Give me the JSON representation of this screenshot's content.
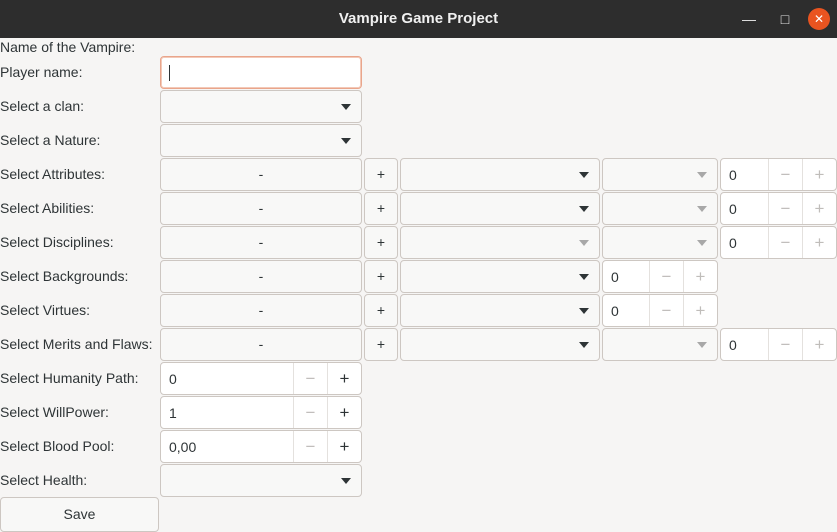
{
  "window": {
    "title": "Vampire Game Project",
    "minimize": "—",
    "maximize": "□",
    "close": "✕"
  },
  "form": {
    "name_label": "Name of the Vampire:",
    "player_label": "Player name:",
    "player_value": "",
    "clan_label": "Select a clan:",
    "nature_label": "Select a Nature:",
    "attributes_label": "Select Attributes:",
    "abilities_label": "Select Abilities:",
    "disciplines_label": "Select Disciplines:",
    "backgrounds_label": "Select Backgrounds:",
    "virtues_label": "Select Virtues:",
    "merits_label": "Select Merits and Flaws:",
    "humanity_label": "Select Humanity Path:",
    "willpower_label": "Select WillPower:",
    "bloodpool_label": "Select Blood Pool:",
    "health_label": "Select Health:",
    "minus_label": "-",
    "plus_label": "+",
    "spin_minus": "−",
    "spin_plus": "+",
    "attributes_value": "0",
    "abilities_value": "0",
    "disciplines_value": "0",
    "backgrounds_value": "0",
    "virtues_value": "0",
    "merits_value": "0",
    "humanity_value": "0",
    "willpower_value": "1",
    "bloodpool_value": "0,00",
    "save_label": "Save"
  },
  "colors": {
    "titlebar": "#2d2d2d",
    "close_button": "#e95420",
    "background": "#f6f5f4",
    "focus_border": "#e9a58b"
  }
}
